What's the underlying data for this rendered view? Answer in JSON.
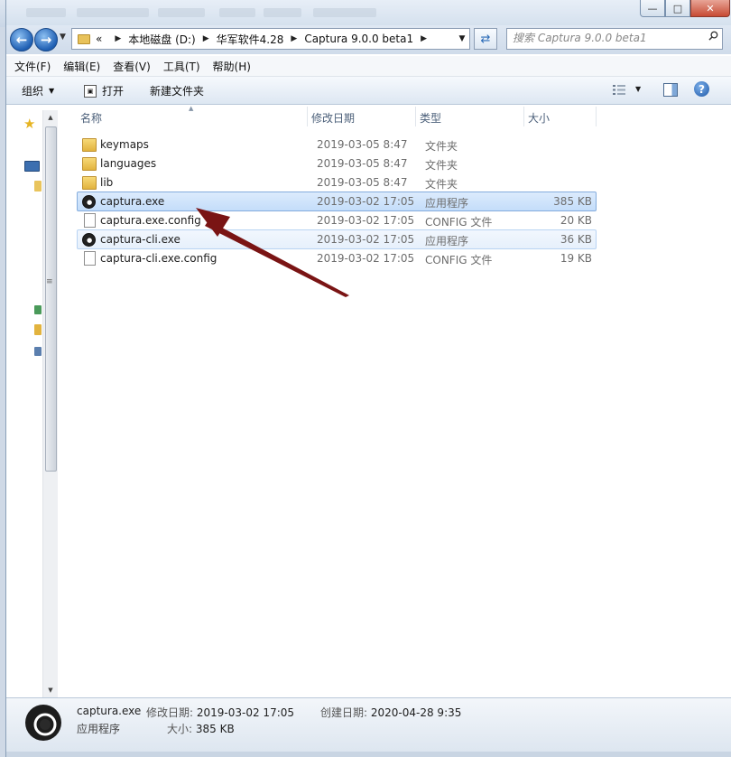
{
  "navigation": {
    "back_label": "back",
    "forward_label": "forward",
    "breadcrumb": {
      "overflow": "«",
      "items": [
        "本地磁盘 (D:)",
        "华军软件4.28",
        "Captura 9.0.0 beta1"
      ]
    },
    "search_placeholder": "搜索 Captura 9.0.0 beta1"
  },
  "menu": {
    "items": [
      "文件(F)",
      "编辑(E)",
      "查看(V)",
      "工具(T)",
      "帮助(H)"
    ]
  },
  "toolbar": {
    "organize": "组织",
    "open": "打开",
    "new_folder": "新建文件夹"
  },
  "columns": {
    "name": "名称",
    "modified": "修改日期",
    "type": "类型",
    "size": "大小"
  },
  "files": [
    {
      "name": "keymaps",
      "modified": "2019-03-05 8:47",
      "type": "文件夹",
      "size": "",
      "icon": "folder-icon"
    },
    {
      "name": "languages",
      "modified": "2019-03-05 8:47",
      "type": "文件夹",
      "size": "",
      "icon": "folder-icon"
    },
    {
      "name": "lib",
      "modified": "2019-03-05 8:47",
      "type": "文件夹",
      "size": "",
      "icon": "folder-icon"
    },
    {
      "name": "captura.exe",
      "modified": "2019-03-02 17:05",
      "type": "应用程序",
      "size": "385 KB",
      "icon": "app-icon"
    },
    {
      "name": "captura.exe.config",
      "modified": "2019-03-02 17:05",
      "type": "CONFIG 文件",
      "size": "20 KB",
      "icon": "file-icon"
    },
    {
      "name": "captura-cli.exe",
      "modified": "2019-03-02 17:05",
      "type": "应用程序",
      "size": "36 KB",
      "icon": "app-icon"
    },
    {
      "name": "captura-cli.exe.config",
      "modified": "2019-03-02 17:05",
      "type": "CONFIG 文件",
      "size": "19 KB",
      "icon": "file-icon"
    }
  ],
  "details": {
    "name": "captura.exe",
    "type": "应用程序",
    "modified_label": "修改日期:",
    "modified_value": "2019-03-02 17:05",
    "created_label": "创建日期:",
    "created_value": "2020-04-28 9:35",
    "size_label": "大小:",
    "size_value": "385 KB"
  },
  "colors": {
    "selection": "#c4ddfa",
    "annotation_arrow": "#7a1414"
  }
}
